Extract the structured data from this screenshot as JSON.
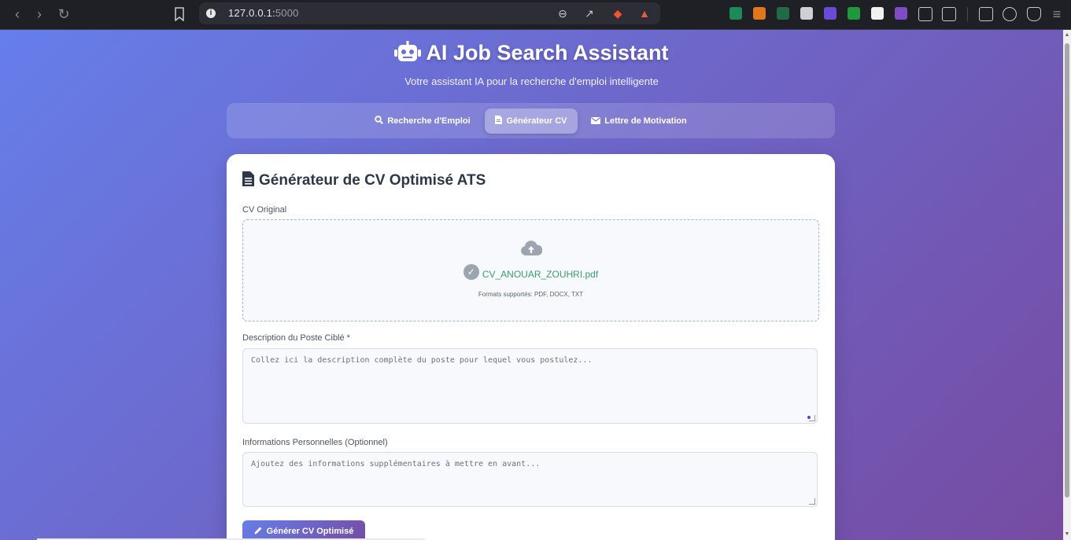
{
  "browser": {
    "url_host": "127.0.0.1:",
    "url_port": "5000"
  },
  "header": {
    "title": "AI Job Search Assistant",
    "subtitle": "Votre assistant IA pour la recherche d'emploi intelligente"
  },
  "tabs": [
    {
      "label": "Recherche d'Emploi",
      "icon": "search-icon",
      "active": false
    },
    {
      "label": "Générateur CV",
      "icon": "file-icon",
      "active": true
    },
    {
      "label": "Lettre de Motivation",
      "icon": "envelope-icon",
      "active": false
    }
  ],
  "card": {
    "title": "Générateur de CV Optimisé ATS",
    "cv_label": "CV Original",
    "file_name": "CV_ANOUAR_ZOUHRI.pdf",
    "formats": "Formats supportés: PDF, DOCX, TXT",
    "job_label": "Description du Poste Ciblé *",
    "job_placeholder": "Collez ici la description complète du poste pour lequel vous postulez...",
    "info_label": "Informations Personnelles (Optionnel)",
    "info_placeholder": "Ajoutez des informations supplémentaires à mettre en avant...",
    "generate_label": "Générer CV Optimisé"
  },
  "colors": {
    "gradient_start": "#667eea",
    "gradient_end": "#764ba2",
    "success": "#38a169"
  }
}
